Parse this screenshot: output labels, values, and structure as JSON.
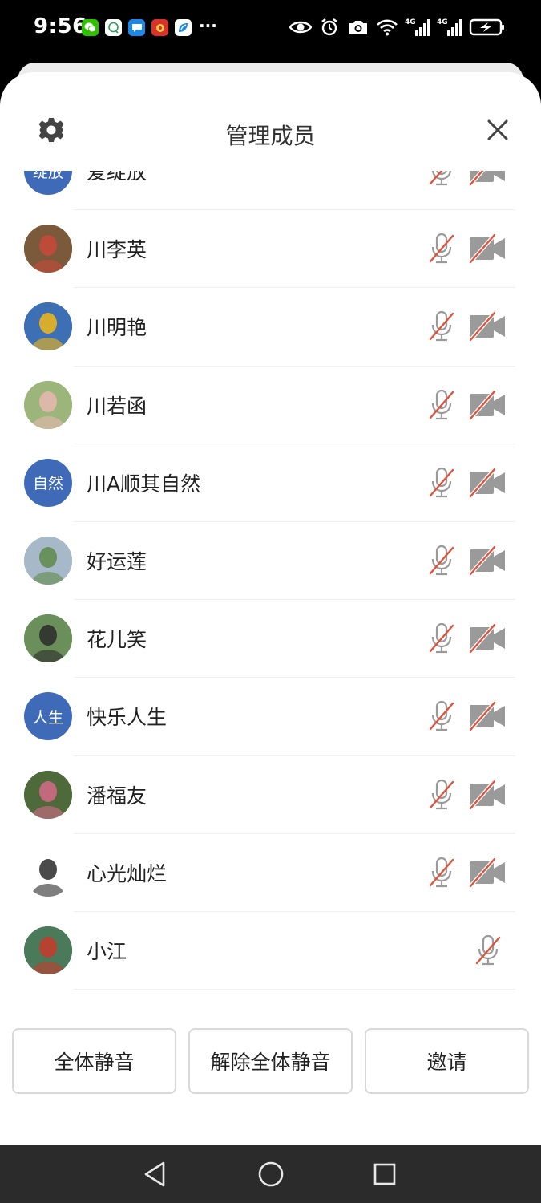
{
  "status_bar": {
    "time": "9:56",
    "more": "···",
    "app_icons": [
      "wechat-icon",
      "chat-icon",
      "message-icon",
      "app-red-icon",
      "app-blue-icon"
    ],
    "system_icons": [
      "eye-icon",
      "alarm-icon",
      "camera-icon",
      "wifi-icon",
      "signal-4g-icon",
      "signal-4g-icon",
      "battery-charging-icon"
    ],
    "network_label": "4G"
  },
  "header": {
    "title": "管理成员",
    "settings_icon": "gear-icon",
    "close_icon": "close-icon"
  },
  "members": [
    {
      "name": "爱绽放",
      "avatar_type": "text",
      "avatar_text": "绽放",
      "avatar_color": "#3e6ab7",
      "mic_muted": true,
      "camera": "off"
    },
    {
      "name": "川李英",
      "avatar_type": "photo",
      "avatar_color": "#7a5a3a",
      "avatar_accent": "#c84a3a",
      "mic_muted": true,
      "camera": "off"
    },
    {
      "name": "川明艳",
      "avatar_type": "photo",
      "avatar_color": "#3d6fb5",
      "avatar_accent": "#f2b818",
      "mic_muted": true,
      "camera": "off"
    },
    {
      "name": "川若函",
      "avatar_type": "photo",
      "avatar_color": "#9bb57a",
      "avatar_accent": "#e8b9b0",
      "mic_muted": true,
      "camera": "off"
    },
    {
      "name": "川A顺其自然",
      "avatar_type": "text",
      "avatar_text": "自然",
      "avatar_color": "#3e6ab7",
      "mic_muted": true,
      "camera": "off"
    },
    {
      "name": "好运莲",
      "avatar_type": "photo",
      "avatar_color": "#a7b8c9",
      "avatar_accent": "#5d8a4a",
      "mic_muted": true,
      "camera": "off"
    },
    {
      "name": "花儿笑",
      "avatar_type": "photo",
      "avatar_color": "#6b8f5a",
      "avatar_accent": "#2a2a2a",
      "mic_muted": true,
      "camera": "off"
    },
    {
      "name": "快乐人生",
      "avatar_type": "text",
      "avatar_text": "人生",
      "avatar_color": "#3e6ab7",
      "mic_muted": true,
      "camera": "off"
    },
    {
      "name": "潘福友",
      "avatar_type": "photo",
      "avatar_color": "#4f6a3a",
      "avatar_accent": "#d66a8a",
      "mic_muted": true,
      "camera": "off"
    },
    {
      "name": "心光灿烂",
      "avatar_type": "photo",
      "avatar_color": "#ffffff",
      "avatar_accent": "#2a2a2a",
      "mic_muted": true,
      "camera": "off"
    },
    {
      "name": "小江",
      "avatar_type": "photo",
      "avatar_color": "#4a7a5a",
      "avatar_accent": "#c83a2a",
      "mic_muted": true,
      "camera": "none"
    }
  ],
  "actions": {
    "mute_all": "全体静音",
    "unmute_all": "解除全体静音",
    "invite": "邀请"
  },
  "colors": {
    "muted_slash": "#e0523c",
    "icon_gray": "#9a9a9a",
    "text_avatar_blue": "#3e6ab7"
  },
  "nav": {
    "back_icon": "triangle-back-icon",
    "home_icon": "circle-home-icon",
    "recents_icon": "square-recents-icon"
  }
}
